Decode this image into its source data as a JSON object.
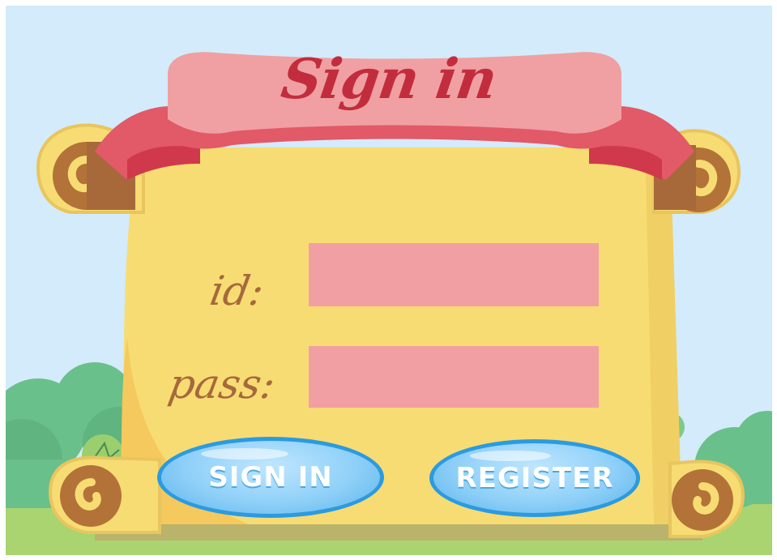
{
  "title": "Sign in",
  "form": {
    "id_label": "id:",
    "pass_label": "pass:",
    "id_value": "",
    "pass_value": ""
  },
  "buttons": {
    "sign_in": "SIGN IN",
    "register": "REGISTER"
  },
  "colors": {
    "sky": "#d3ebfb",
    "scroll": "#f7dc73",
    "ribbon": "#f0a0a2",
    "ribbon_dark": "#e25968",
    "title": "#c22d3e",
    "label": "#a6683c",
    "field": "#f19fa3",
    "button": "#8fd0f8",
    "button_border": "#2b9be1"
  }
}
